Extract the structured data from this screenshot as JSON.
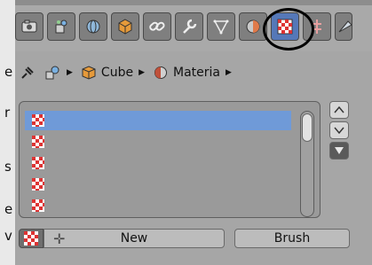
{
  "left_text_fragments": [
    "e",
    "r",
    "s",
    "e",
    "v"
  ],
  "tabs": [
    {
      "icon": "render-icon"
    },
    {
      "icon": "render-layers-icon"
    },
    {
      "icon": "scene-icon"
    },
    {
      "icon": "world-icon"
    },
    {
      "icon": "object-icon"
    },
    {
      "icon": "constraints-icon"
    },
    {
      "icon": "modifiers-icon"
    },
    {
      "icon": "object-data-icon"
    },
    {
      "icon": "material-icon",
      "active": true
    },
    {
      "icon": "texture-icon"
    },
    {
      "icon": "particles-icon"
    }
  ],
  "breadcrumb": {
    "items": [
      {
        "label": "Cube",
        "icon": "cube-icon"
      },
      {
        "label": "Materia",
        "icon": "material-sphere-icon"
      }
    ]
  },
  "material_slots": [
    {
      "selected": true
    },
    {
      "selected": false
    },
    {
      "selected": false
    },
    {
      "selected": false
    },
    {
      "selected": false
    }
  ],
  "buttons": {
    "new": "New",
    "brush": "Brush"
  },
  "colors": {
    "selection": "#6f9ad8",
    "active_tab": "#5578b8",
    "panel": "#a6a6a6"
  }
}
